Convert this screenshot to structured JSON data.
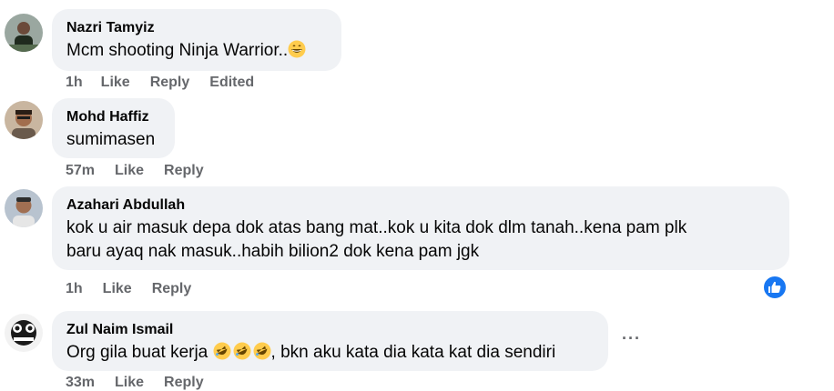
{
  "comments": [
    {
      "author": "Nazri Tamyiz",
      "text": "Mcm shooting Ninja Warrior..",
      "emoji": "grinning-face-emoji",
      "time": "1h",
      "like": "Like",
      "reply": "Reply",
      "edited": "Edited"
    },
    {
      "author": "Mohd Haffiz",
      "text": "sumimasen",
      "time": "57m",
      "like": "Like",
      "reply": "Reply"
    },
    {
      "author": "Azahari Abdullah",
      "text_line1": "kok u air masuk depa dok atas bang mat..kok u kita dok dlm tanah..kena pam plk",
      "text_line2": "baru ayaq nak masuk..habih bilion2 dok kena pam jgk",
      "time": "1h",
      "like": "Like",
      "reply": "Reply",
      "reaction_icon": "thumbs-up-icon"
    },
    {
      "author": "Zul Naim Ismail",
      "text_prefix": "Org gila buat kerja ",
      "emojis": [
        "rolling-laughing-emoji",
        "rolling-laughing-emoji",
        "rolling-laughing-emoji"
      ],
      "text_suffix": ", bkn aku kata dia kata kat dia sendiri",
      "time": "33m",
      "like": "Like",
      "reply": "Reply",
      "more": "···"
    }
  ],
  "colors": {
    "bubble": "#f0f2f5",
    "meta": "#65676b",
    "like_blue": "#1877f2"
  }
}
